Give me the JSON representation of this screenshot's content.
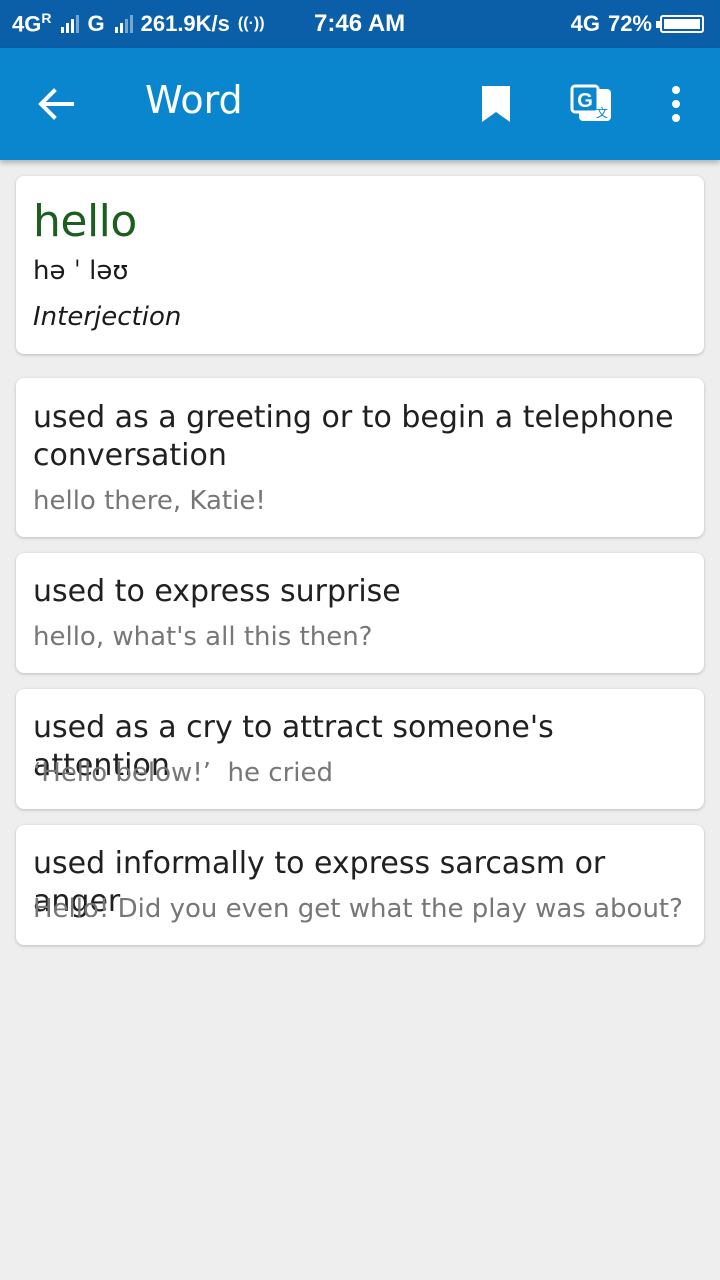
{
  "status_bar": {
    "network_1": "4G",
    "roaming": "R",
    "network_2": "G",
    "speed": "261.9K/s",
    "time": "7:46 AM",
    "network_3": "4G",
    "battery": "72%"
  },
  "app_bar": {
    "title": "Word",
    "icons": [
      "back-arrow-icon",
      "bookmark-icon",
      "translate-icon",
      "more-vert-icon"
    ]
  },
  "entry": {
    "word": "hello",
    "pronunciation": "hə ˈ ləʊ",
    "part_of_speech": "Interjection"
  },
  "definitions": [
    {
      "definition": "used as a greeting or to begin a telephone conversation",
      "example": "hello there, Katie!"
    },
    {
      "definition": "used to express surprise",
      "example": "hello, what's all this then?"
    },
    {
      "definition": "used as a cry to attract someone's attention",
      "example": "‘Hello below!’  he cried"
    },
    {
      "definition": "used informally to express sarcasm or anger",
      "example": "Hello! Did you even get what the play was about?"
    }
  ],
  "colors": {
    "status_bar": "#0b5ea8",
    "app_bar": "#0a86cf",
    "headword": "#1b5e20",
    "background": "#eeeeee"
  }
}
